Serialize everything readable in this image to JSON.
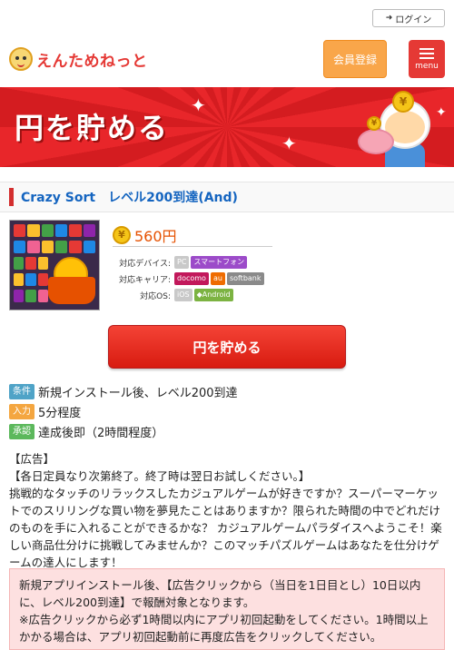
{
  "header": {
    "login_label": "ログイン",
    "logo_text": "えんためねっと",
    "register_label": "会員登録",
    "menu_label": "menu"
  },
  "banner": {
    "title": "円を貯める"
  },
  "offer": {
    "title": "Crazy Sort　レベル200到達(And)",
    "price": "560円",
    "device_label": "対応デバイス:",
    "devices": [
      "PC",
      "スマートフォン"
    ],
    "carrier_label": "対応キャリア:",
    "carriers": [
      "docomo",
      "au",
      "softbank"
    ],
    "os_label": "対応OS:",
    "os": [
      "iOS",
      "Android"
    ]
  },
  "cta_label": "円を貯める",
  "conditions": [
    {
      "tag": "条件",
      "text": "新規インストール後、レベル200到達",
      "color": "#4fa3c7"
    },
    {
      "tag": "入力",
      "text": "5分程度",
      "color": "#f4a640"
    },
    {
      "tag": "承認",
      "text": "達成後即（2時間程度）",
      "color": "#5cb85c"
    }
  ],
  "description": {
    "line1": "【広告】",
    "line2": "【各日定員なり次第終了。終了時は翌日お試しください。】",
    "body": "挑戦的なタッチのリラックスしたカジュアルゲームが好きですか？スーパーマーケットでのスリリングな買い物を夢見たことはありますか？限られた時間の中でどれだけのものを手に入れることができるかな？ カジュアルゲームパラダイスへようこそ！楽しい商品仕分けに挑戦してみませんか？このマッチパズルゲームはあなたを仕分けゲームの達人にします！"
  },
  "notice": {
    "line1": "新規アプリインストール後、【広告クリックから（当日を1日目とし）10日以内に、レベル200到達】で報酬対象となります。",
    "line2": "※広告クリックから必ず1時間以内にアプリ初回起動をしてください。1時間以上かかる場合は、アプリ初回起動前に再度広告をクリックしてください。"
  },
  "colors": {
    "brand_red": "#e53935",
    "register_orange": "#f9a64a",
    "title_blue": "#1565c0",
    "price_orange": "#e65100"
  }
}
